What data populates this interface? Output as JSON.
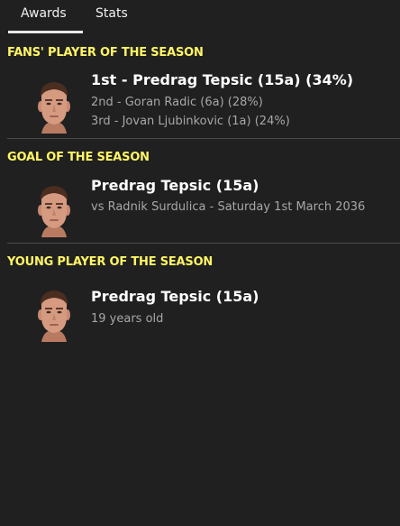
{
  "tabs": {
    "awards": "Awards",
    "stats": "Stats"
  },
  "awards": [
    {
      "heading": "FANS' PLAYER OF THE SEASON",
      "title": "1st - Predrag Tepsic (15a) (34%)",
      "lines": [
        "2nd - Goran Radic (6a) (28%)",
        "3rd - Jovan Ljubinkovic (1a) (24%)"
      ]
    },
    {
      "heading": "GOAL OF THE SEASON",
      "title": "Predrag Tepsic (15a)",
      "lines": [
        "vs Radnik Surdulica - Saturday 1st March 2036"
      ]
    },
    {
      "heading": "YOUNG PLAYER OF THE SEASON",
      "title": "Predrag Tepsic (15a)",
      "lines": [
        "19 years old"
      ]
    }
  ],
  "colors": {
    "background": "#202020",
    "heading": "#fff566",
    "subtext": "#a7a7a7",
    "divider": "#4a4a4a"
  }
}
